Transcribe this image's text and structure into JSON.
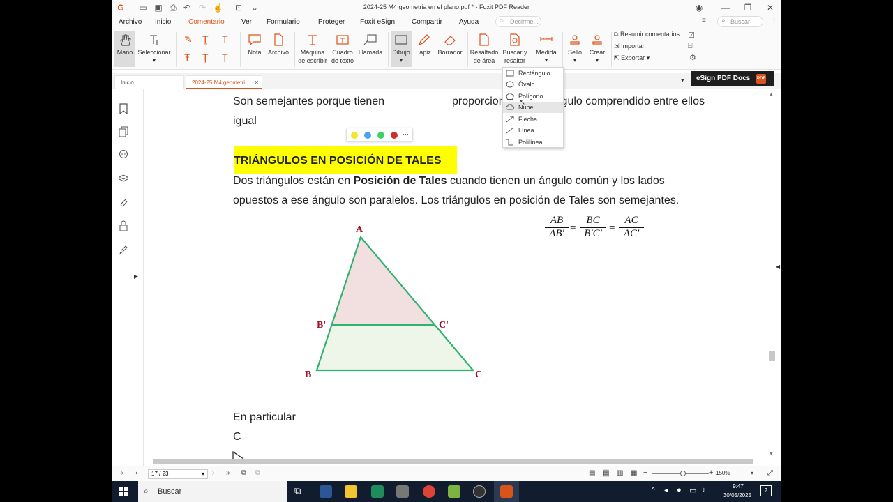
{
  "window": {
    "title": "2024-25 M4 geometria en el plano.pdf * - Foxit PDF Reader"
  },
  "menu": {
    "items": [
      "Archivo",
      "Inicio",
      "Comentario",
      "Ver",
      "Formulario",
      "Proteger",
      "Foxit eSign",
      "Compartir",
      "Ayuda"
    ],
    "active": "Comentario",
    "tellme_placeholder": "Decirme...",
    "search_placeholder": "Buscar"
  },
  "ribbon": {
    "mano": "Mano",
    "seleccionar": "Seleccionar",
    "nota": "Nota",
    "archivo": "Archivo",
    "maquina_1": "Máquina",
    "maquina_2": "de escribir",
    "cuadro_1": "Cuadro",
    "cuadro_2": "de texto",
    "llamada": "Llamada",
    "dibujo": "Dibujo",
    "lapiz": "Lápiz",
    "borrador": "Borrador",
    "resaltado_1": "Resaltado",
    "resaltado_2": "de área",
    "buscar_1": "Buscar y",
    "buscar_2": "resaltar",
    "medida": "Medida",
    "sello": "Sello",
    "crear": "Crear",
    "resumir": "Resumir comentarios",
    "importar": "Importar",
    "exportar": "Exportar"
  },
  "tabs": {
    "home": "Inicio",
    "doc": "2024-25 M4 geometri..."
  },
  "esign": {
    "label": "eSign PDF Docs"
  },
  "dropdown": {
    "items": [
      "Rectángulo",
      "Óvalo",
      "Polígono",
      "Nube",
      "Flecha",
      "Línea",
      "Polilínea"
    ],
    "highlighted": "Nube"
  },
  "document": {
    "line1": "Son semejantes porque tienen",
    "line1b": "proporcionales y el ángulo comprendido entre ellos",
    "line2": "igual",
    "heading": "TRIÁNGULOS EN POSICIÓN DE TALES",
    "para1_a": "Dos triángulos están en ",
    "para1_b": "Posición de Tales",
    "para1_c": " cuando tienen un ángulo común y los lados",
    "para2": "opuestos a ese ángulo son paralelos. Los triángulos en posición de Tales son semejantes.",
    "formula": {
      "n1": "AB",
      "d1": "AB'",
      "n2": "BC",
      "d2": "B'C'",
      "n3": "AC",
      "d3": "AC'",
      "eq": "="
    },
    "labels": {
      "A": "A",
      "B": "B",
      "C": "C",
      "Bp": "B'",
      "Cp": "C'"
    },
    "en_particular": "En particular",
    "c_line": "C"
  },
  "colors": {
    "yellow": "#f2e72b",
    "blue": "#4aa3ef",
    "green": "#3ccf6a",
    "red": "#c8342a",
    "triangle_stroke": "#2fb36f",
    "upper_fill": "#f2dfe0",
    "lower_fill": "#edf6e8",
    "label_red": "#a0122a",
    "accent": "#d9541a"
  },
  "statusbar": {
    "page": "17 / 23",
    "zoom": "150%"
  },
  "taskbar": {
    "search": "Buscar",
    "time": "9:47",
    "date": "30/05/2025",
    "notif": "2"
  }
}
